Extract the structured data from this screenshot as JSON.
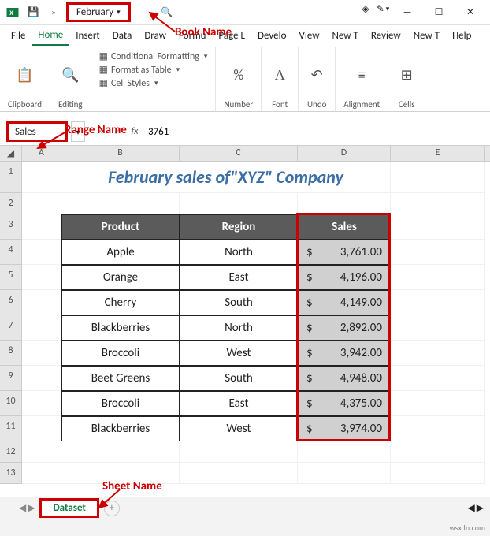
{
  "title": {
    "workbook": "February"
  },
  "annotations": {
    "book": "Book Name",
    "range": "Range Name",
    "sheet": "Sheet Name"
  },
  "menu": {
    "file": "File",
    "home": "Home",
    "insert": "Insert",
    "data": "Data",
    "draw": "Draw",
    "formulas": "Formu",
    "pagelayout": "Page L",
    "developer": "Develo",
    "view": "View",
    "newt1": "New T",
    "review": "Review",
    "newt2": "New T",
    "help": "Help"
  },
  "ribbon": {
    "clipboard": "Clipboard",
    "editing": "Editing",
    "number": "Number",
    "font": "Font",
    "undo": "Undo",
    "alignment": "Alignment",
    "cells": "Cells",
    "cf": "Conditional Formatting",
    "fat": "Format as Table",
    "cs": "Cell Styles"
  },
  "namebox": "Sales",
  "formula": "3761",
  "sheet_title": "February sales of\"XYZ\" Company",
  "headers": {
    "product": "Product",
    "region": "Region",
    "sales": "Sales"
  },
  "rows": [
    {
      "product": "Apple",
      "region": "North",
      "sales": "3,761.00"
    },
    {
      "product": "Orange",
      "region": "East",
      "sales": "4,196.00"
    },
    {
      "product": "Cherry",
      "region": "South",
      "sales": "4,149.00"
    },
    {
      "product": "Blackberries",
      "region": "North",
      "sales": "2,892.00"
    },
    {
      "product": "Broccoli",
      "region": "West",
      "sales": "3,942.00"
    },
    {
      "product": "Beet Greens",
      "region": "South",
      "sales": "4,948.00"
    },
    {
      "product": "Broccoli",
      "region": "East",
      "sales": "4,375.00"
    },
    {
      "product": "Blackberries",
      "region": "West",
      "sales": "3,974.00"
    }
  ],
  "currency": "$",
  "sheet_tab": "Dataset",
  "watermark": "wsxdn.com",
  "cols": [
    "A",
    "B",
    "C",
    "D",
    "E"
  ]
}
